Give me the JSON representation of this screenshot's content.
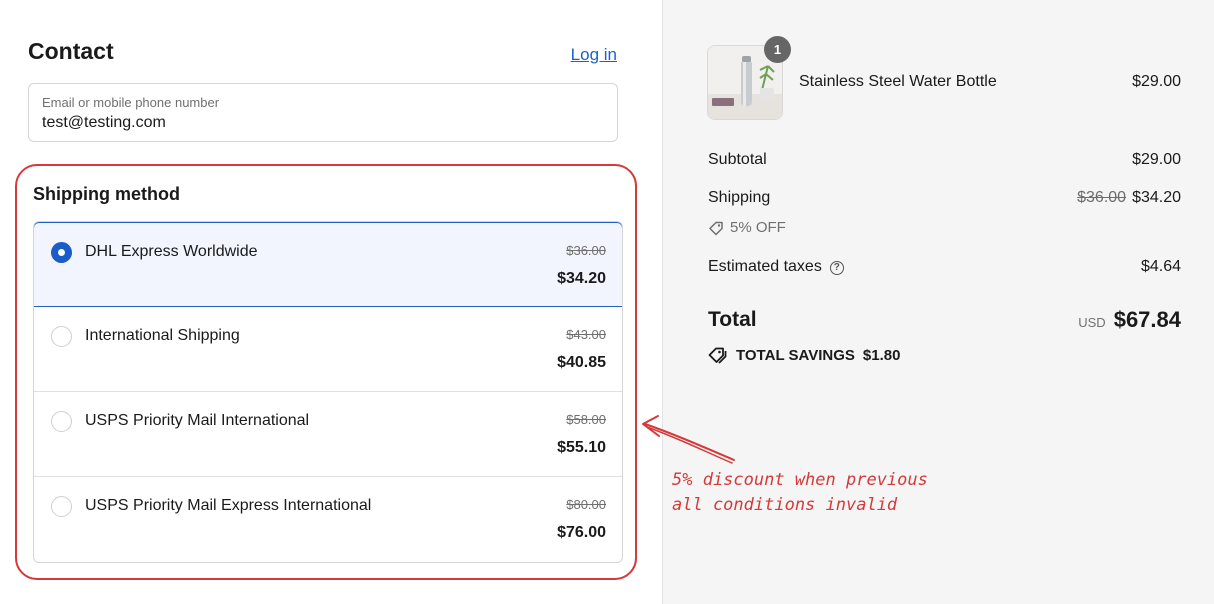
{
  "contact": {
    "title": "Contact",
    "login_label": "Log in",
    "email_label": "Email or mobile phone number",
    "email_value": "test@testing.com"
  },
  "shipping": {
    "title": "Shipping method",
    "options": [
      {
        "name": "DHL Express Worldwide",
        "old_price": "$36.00",
        "price": "$34.20",
        "selected": true
      },
      {
        "name": "International Shipping",
        "old_price": "$43.00",
        "price": "$40.85",
        "selected": false
      },
      {
        "name": "USPS Priority Mail International",
        "old_price": "$58.00",
        "price": "$55.10",
        "selected": false
      },
      {
        "name": "USPS Priority Mail Express International",
        "old_price": "$80.00",
        "price": "$76.00",
        "selected": false
      }
    ]
  },
  "annotation": {
    "line1": "5% discount when previous",
    "line2": "all conditions invalid",
    "color": "#d43a3a"
  },
  "summary": {
    "item": {
      "name": "Stainless Steel Water Bottle",
      "price": "$29.00",
      "quantity": "1",
      "image_icon": "water-bottle-thumbnail"
    },
    "subtotal_label": "Subtotal",
    "subtotal_value": "$29.00",
    "shipping_label": "Shipping",
    "shipping_old": "$36.00",
    "shipping_value": "$34.20",
    "discount_label": "5% OFF",
    "taxes_label": "Estimated taxes",
    "taxes_value": "$4.64",
    "total_label": "Total",
    "currency": "USD",
    "total_value": "$67.84",
    "savings_label": "TOTAL SAVINGS",
    "savings_value": "$1.80"
  },
  "colors": {
    "accent": "#1a5cc8",
    "link": "#1a62c9",
    "highlight": "#d43a3a",
    "summary_bg": "#f5f5f5"
  }
}
